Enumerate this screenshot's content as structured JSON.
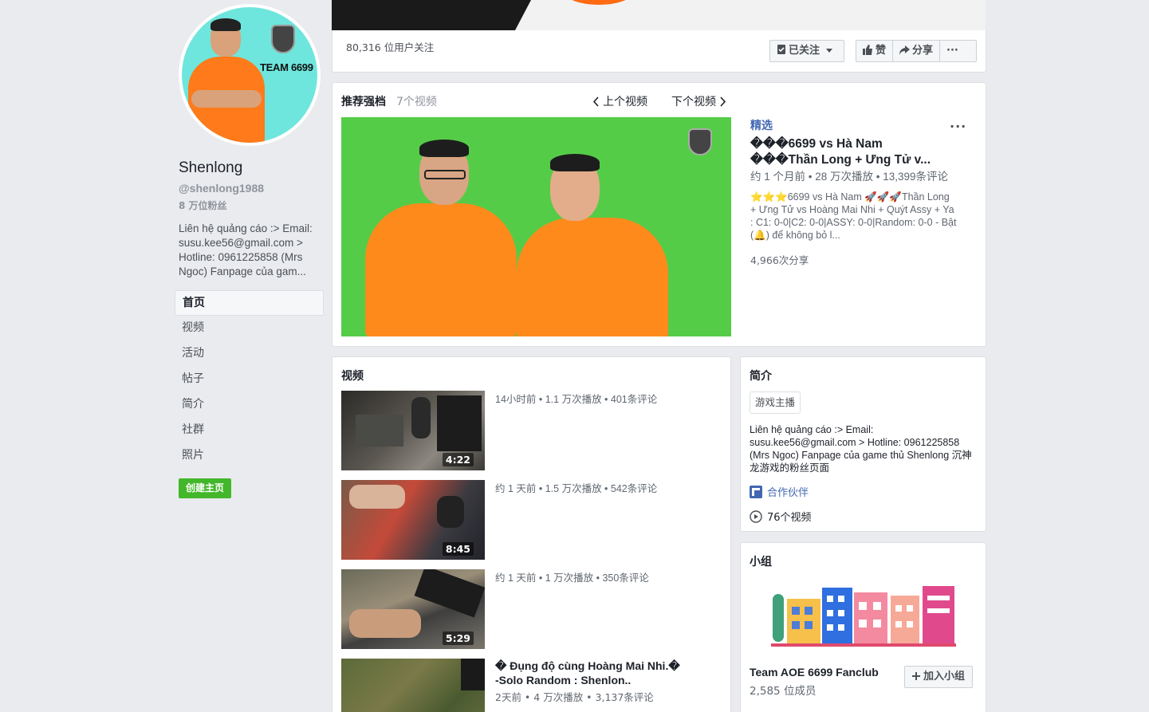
{
  "profile": {
    "avatar_text": "TEAM 6699",
    "name": "Shenlong",
    "handle": "@shenlong1988",
    "fans": "8 万位粉丝",
    "about_short": "Liên hệ quảng cáo :> Email: susu.kee56@gmail.com > Hotline: 0961225858 (Mrs Ngoc) Fanpage của gam..."
  },
  "nav": {
    "items": [
      {
        "label": "首页",
        "active": true
      },
      {
        "label": "视频"
      },
      {
        "label": "活动"
      },
      {
        "label": "帖子"
      },
      {
        "label": "简介"
      },
      {
        "label": "社群"
      },
      {
        "label": "照片"
      }
    ],
    "create_page": "创建主页"
  },
  "followbar": {
    "follower_count": "80,316 位用户关注",
    "followed_label": "已关注",
    "like_label": "赞",
    "share_label": "分享",
    "more_label": "···"
  },
  "featured": {
    "title": "推荐强档",
    "count": "7个视频",
    "prev": "上个视频",
    "next": "下个视频",
    "label": "精选",
    "heading": "���6699 vs Hà Nam ���Thần Long + Ưng Tử v...",
    "stats": "约 1 个月前 • 28 万次播放 • 13,399条评论",
    "description": "⭐⭐⭐6699 vs Hà Nam 🚀🚀🚀Thần Long + Ưng Tử vs Hoàng Mai Nhi + Quýt Assy + Ya : C1: 0-0|C2: 0-0|ASSY: 0-0|Random: 0-0 - Bật (🔔) để không bỏ l...",
    "shares": "4,966次分享",
    "more": "···"
  },
  "videos": {
    "title": "视频",
    "items": [
      {
        "meta": "14小时前 • 1.1 万次播放 • 401条评论",
        "duration": "4:22"
      },
      {
        "meta": "约 1 天前 • 1.5 万次播放 • 542条评论",
        "duration": "8:45"
      },
      {
        "meta": "约 1 天前 • 1 万次播放 • 350条评论",
        "duration": "5:29"
      },
      {
        "title": "� Đụng độ cùng Hoàng Mai Nhi.� -Solo Random : Shenlon..",
        "meta": "2天前 • 4 万次播放 • 3,137条评论"
      }
    ]
  },
  "intro": {
    "title": "简介",
    "tag": "游戏主播",
    "text": "Liên hệ quảng cáo :> Email: susu.kee56@gmail.com > Hotline: 0961225858 (Mrs Ngoc) Fanpage của game thủ Shenlong 沉神龙游戏的粉丝页面",
    "partner": "合作伙伴",
    "video_count": "76个视频"
  },
  "groups": {
    "title": "小组",
    "name": "Team AOE 6699 Fanclub",
    "members": "2,585 位成员",
    "join": "加入小组"
  },
  "colors": {
    "accent": "#4267b2",
    "create_green": "#42b72a",
    "jersey_orange": "#ff8a1c",
    "video_bg_green": "#55cc47",
    "page_bg": "#e9ebee"
  }
}
